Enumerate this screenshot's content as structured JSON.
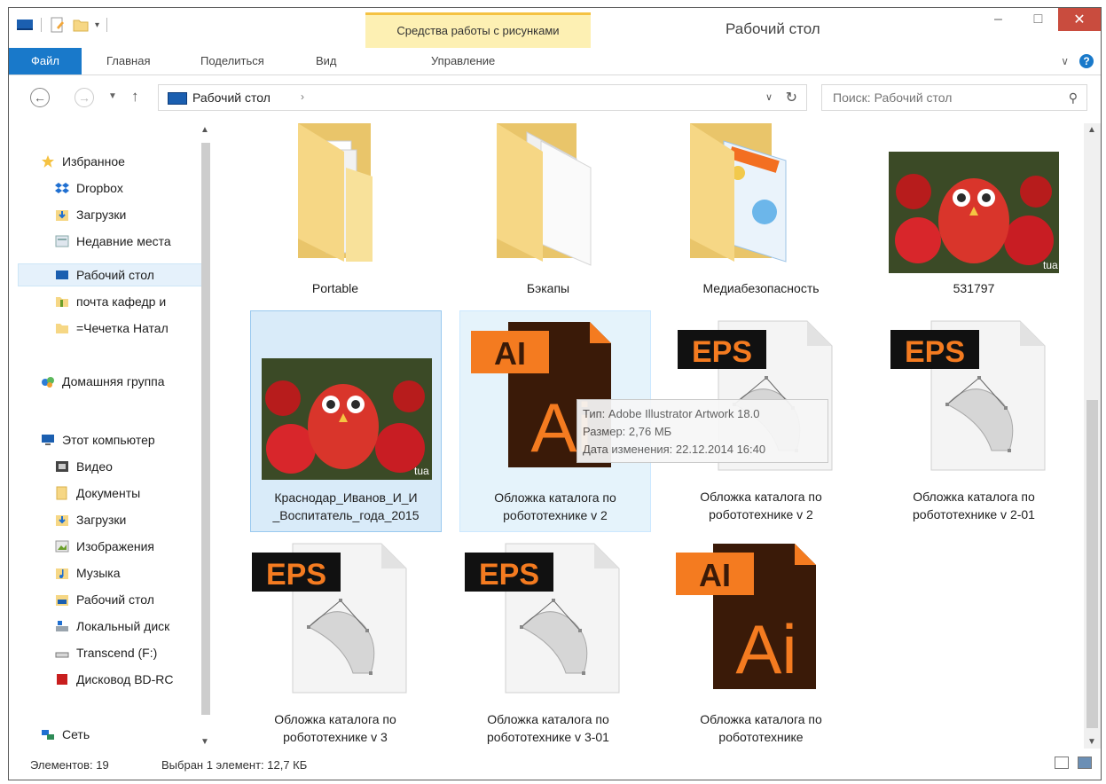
{
  "window": {
    "title": "Рабочий стол",
    "context_tab_group": "Средства работы с рисунками",
    "controls": {
      "minimize": "–",
      "maximize": "□",
      "close": "✕"
    }
  },
  "ribbon": {
    "tabs": [
      "Файл",
      "Главная",
      "Поделиться",
      "Вид",
      "Управление"
    ]
  },
  "address": {
    "path": "Рабочий стол",
    "search_placeholder": "Поиск: Рабочий стол"
  },
  "nav": {
    "favorites_label": "Избранное",
    "favorites": [
      "Dropbox",
      "Загрузки",
      "Недавние места",
      "Рабочий стол",
      "почта кафедр и",
      "=Чечетка Натал"
    ],
    "homegroup": "Домашняя группа",
    "computer_label": "Этот компьютер",
    "computer": [
      "Видео",
      "Документы",
      "Загрузки",
      "Изображения",
      "Музыка",
      "Рабочий стол",
      "Локальный диск",
      "Transcend (F:)",
      "Дисковод BD-RC"
    ],
    "network": "Сеть",
    "selected": "Рабочий стол"
  },
  "files": [
    {
      "name": "Portable",
      "kind": "folder"
    },
    {
      "name": "Бэкапы",
      "kind": "folder"
    },
    {
      "name": "Медиабезопасность",
      "kind": "folder"
    },
    {
      "name": "531797",
      "kind": "image"
    },
    {
      "name": "Краснодар_Иванов_И_И _Воспитатель_года_2015",
      "kind": "image",
      "selected": true
    },
    {
      "name": "Обложка каталога по робототехнике v 2",
      "kind": "ai",
      "hover": true
    },
    {
      "name": "Обложка каталога по робототехнике v 2",
      "kind": "eps"
    },
    {
      "name": "Обложка каталога по робототехнике v 2-01",
      "kind": "eps"
    },
    {
      "name": "Обложка каталога по робототехнике v 3",
      "kind": "eps"
    },
    {
      "name": "Обложка каталога по робототехнике v 3-01",
      "kind": "eps"
    },
    {
      "name": "Обложка каталога по робототехнике",
      "kind": "ai"
    }
  ],
  "badges": {
    "ai": "AI",
    "ai_big": "Ai",
    "eps": "EPS",
    "photo_watermark": "tua"
  },
  "tooltip": {
    "type": "Тип: Adobe Illustrator Artwork 18.0",
    "size": "Размер: 2,76 МБ",
    "date": "Дата изменения: 22.12.2014 16:40"
  },
  "status": {
    "count": "Элементов: 19",
    "selection": "Выбран 1 элемент: 12,7 КБ"
  },
  "colors": {
    "accent": "#1979ca",
    "ai_orange": "#f47b20",
    "ai_brown": "#3a1a08",
    "close_red": "#c94c3e",
    "folder": "#f6d785"
  },
  "icons": {
    "favorites": "star-icon",
    "dropbox": "dropbox-icon",
    "homegroup": "homegroup-icon",
    "computer": "computer-icon",
    "network": "network-icon"
  }
}
